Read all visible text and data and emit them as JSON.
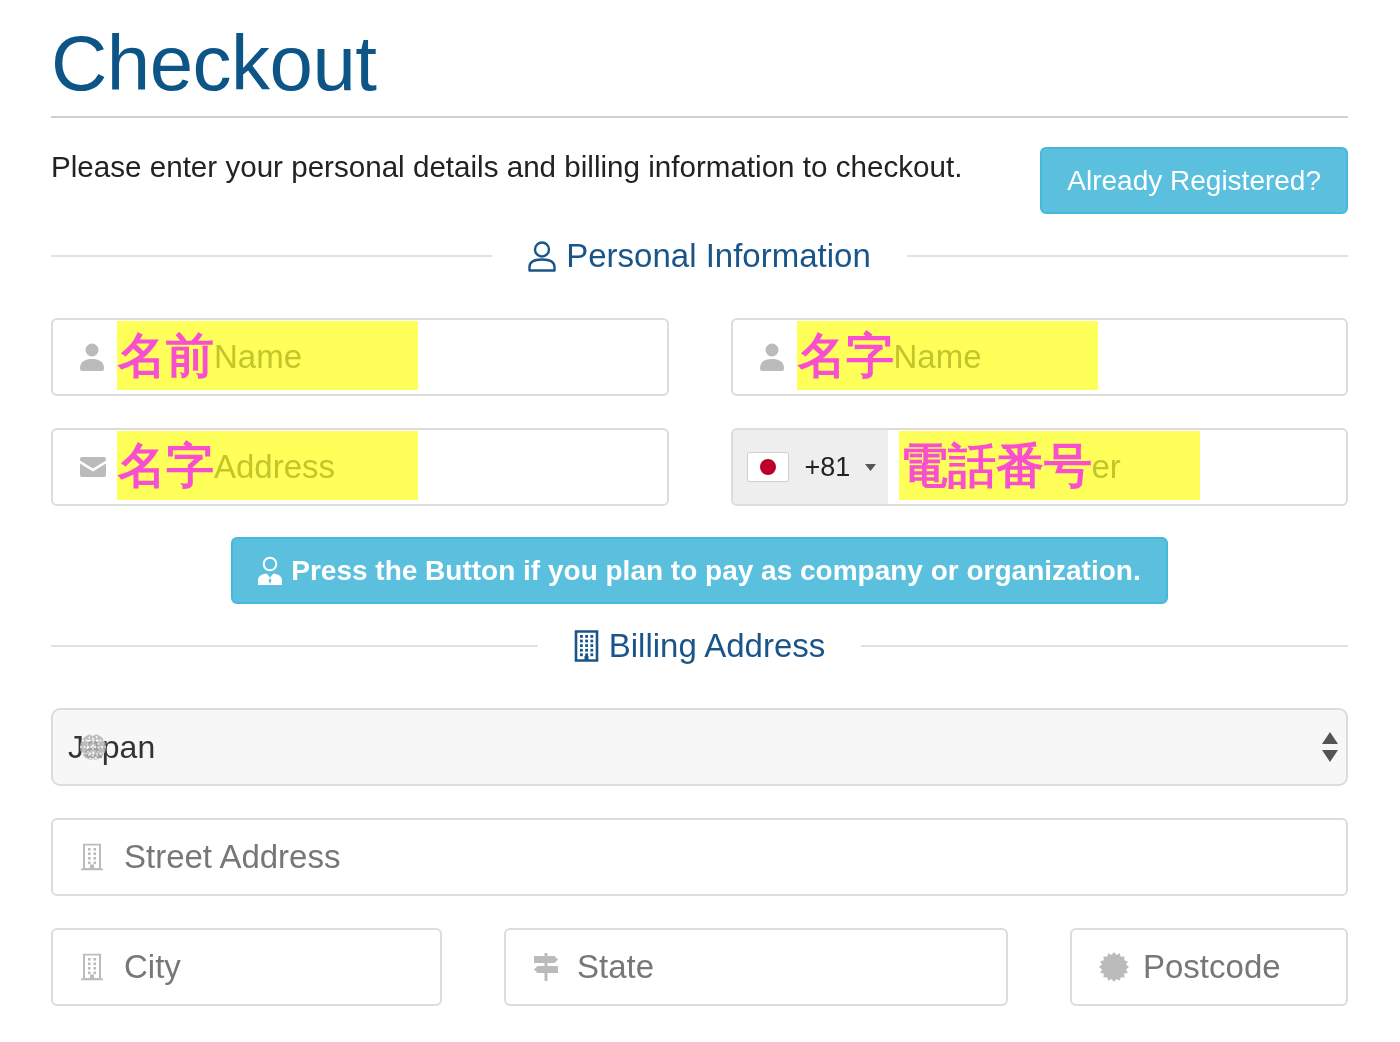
{
  "title": "Checkout",
  "intro": {
    "text": "Please enter your personal details and billing information to checkout.",
    "button": "Already Registered?"
  },
  "personal_section": {
    "heading": "Personal Information",
    "fields": [
      {
        "kind": "name",
        "placeholder": "Name",
        "annotation": "名前"
      },
      {
        "kind": "name",
        "placeholder": "Name",
        "annotation": "名字"
      },
      {
        "kind": "email",
        "placeholder": "Address",
        "annotation": "名字"
      },
      {
        "kind": "phone",
        "country_code": "+81",
        "placeholder": "er",
        "annotation": "電話番号"
      }
    ]
  },
  "company_button": "Press the Button if you plan to pay as company or organization.",
  "billing_section": {
    "heading": "Billing Address",
    "country_select": {
      "value": "Japan"
    },
    "fields": [
      {
        "kind": "street",
        "placeholder": "Street Address"
      },
      {
        "kind": "city",
        "placeholder": "City"
      },
      {
        "kind": "state",
        "placeholder": "State"
      },
      {
        "kind": "postcode",
        "placeholder": "Postcode"
      }
    ]
  }
}
